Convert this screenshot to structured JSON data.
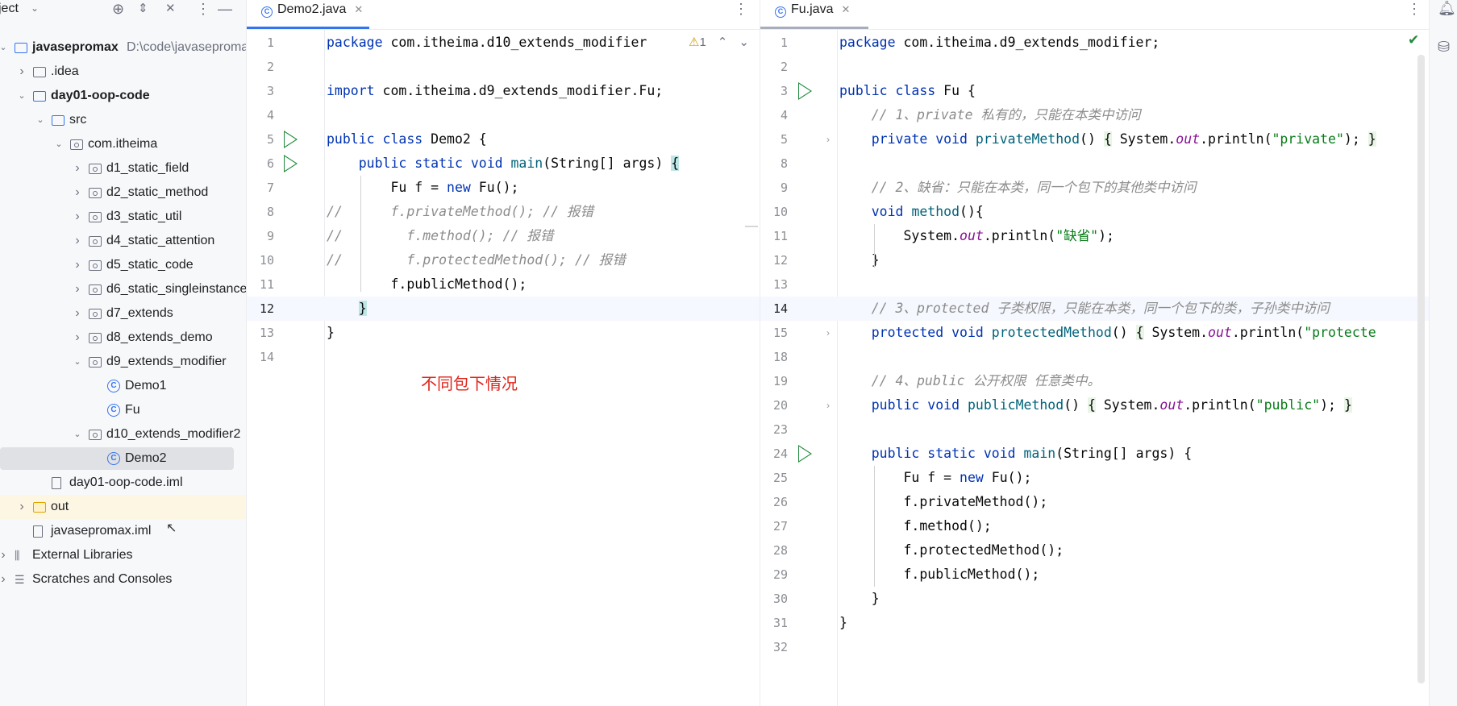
{
  "project_panel": {
    "title": "ject",
    "tree": [
      {
        "label": "javasepromax",
        "path": "D:\\code\\javasepromax",
        "icon": "module-folder-icon",
        "indent": 0,
        "arrow": "down",
        "bold": true
      },
      {
        "label": ".idea",
        "icon": "folder-icon",
        "indent": 1,
        "arrow": "right"
      },
      {
        "label": "day01-oop-code",
        "icon": "module-folder-icon",
        "indent": 1,
        "arrow": "down",
        "bold": true
      },
      {
        "label": "src",
        "icon": "source-folder-icon",
        "indent": 2,
        "arrow": "down"
      },
      {
        "label": "com.itheima",
        "icon": "package-icon",
        "indent": 3,
        "arrow": "down"
      },
      {
        "label": "d1_static_field",
        "icon": "package-icon",
        "indent": 4,
        "arrow": "right"
      },
      {
        "label": "d2_static_method",
        "icon": "package-icon",
        "indent": 4,
        "arrow": "right"
      },
      {
        "label": "d3_static_util",
        "icon": "package-icon",
        "indent": 4,
        "arrow": "right"
      },
      {
        "label": "d4_static_attention",
        "icon": "package-icon",
        "indent": 4,
        "arrow": "right"
      },
      {
        "label": "d5_static_code",
        "icon": "package-icon",
        "indent": 4,
        "arrow": "right"
      },
      {
        "label": "d6_static_singleinstance",
        "icon": "package-icon",
        "indent": 4,
        "arrow": "right"
      },
      {
        "label": "d7_extends",
        "icon": "package-icon",
        "indent": 4,
        "arrow": "right"
      },
      {
        "label": "d8_extends_demo",
        "icon": "package-icon",
        "indent": 4,
        "arrow": "right"
      },
      {
        "label": "d9_extends_modifier",
        "icon": "package-icon",
        "indent": 4,
        "arrow": "down"
      },
      {
        "label": "Demo1",
        "icon": "class-icon",
        "indent": 5,
        "arrow": ""
      },
      {
        "label": "Fu",
        "icon": "class-icon",
        "indent": 5,
        "arrow": ""
      },
      {
        "label": "d10_extends_modifier2",
        "icon": "package-icon",
        "indent": 4,
        "arrow": "down"
      },
      {
        "label": "Demo2",
        "icon": "class-icon",
        "indent": 5,
        "arrow": "",
        "selected": true
      },
      {
        "label": "day01-oop-code.iml",
        "icon": "iml-file-icon",
        "indent": 2,
        "arrow": ""
      },
      {
        "label": "out",
        "icon": "excluded-folder-icon",
        "indent": 1,
        "arrow": "right",
        "highlight": true
      },
      {
        "label": "javasepromax.iml",
        "icon": "iml-file-icon",
        "indent": 1,
        "arrow": ""
      },
      {
        "label": "External Libraries",
        "icon": "libraries-icon",
        "indent": 0,
        "arrow": "right"
      },
      {
        "label": "Scratches and Consoles",
        "icon": "scratches-icon",
        "indent": 0,
        "arrow": "right"
      }
    ]
  },
  "left_editor": {
    "tab_label": "Demo2.java",
    "warning_count": "1",
    "current_line": "12",
    "lines": [
      {
        "n": "1",
        "html": "<span class=\"kw\">package</span> com.itheima.d10_extends_modifier"
      },
      {
        "n": "2",
        "html": ""
      },
      {
        "n": "3",
        "html": "<span class=\"kw\">import</span> com.itheima.d9_extends_modifier.Fu;"
      },
      {
        "n": "4",
        "html": ""
      },
      {
        "n": "5",
        "html": "<span class=\"kw\">public class</span> Demo2 {",
        "run": true
      },
      {
        "n": "6",
        "html": "    <span class=\"kw\">public static void</span> <span class=\"mdecl\">main</span>(String[] args) <span class=\"brh\">{</span>",
        "run": true
      },
      {
        "n": "7",
        "html": "        Fu f = <span class=\"kw\">new</span> Fu();"
      },
      {
        "n": "8",
        "html": "<span class=\"cmt\">//      f.privateMethod(); // 报错</span>"
      },
      {
        "n": "9",
        "html": "<span class=\"cmt\">//        f.method(); // 报错</span>"
      },
      {
        "n": "10",
        "html": "<span class=\"cmt\">//        f.protectedMethod(); // 报错</span>"
      },
      {
        "n": "11",
        "html": "        f.publicMethod();"
      },
      {
        "n": "12",
        "html": "    <span class=\"brh\">}</span>"
      },
      {
        "n": "13",
        "html": "}"
      },
      {
        "n": "14",
        "html": ""
      }
    ],
    "annotation": "不同包下情况"
  },
  "right_editor": {
    "tab_label": "Fu.java",
    "current_line": "14",
    "lines": [
      {
        "n": "1",
        "html": "<span class=\"kw\">package</span> com.itheima.d9_extends_modifier;"
      },
      {
        "n": "2",
        "html": ""
      },
      {
        "n": "3",
        "html": "<span class=\"kw\">public class</span> Fu {",
        "run": true
      },
      {
        "n": "4",
        "html": "    <span class=\"cmt\">// 1、private 私有的，只能在本类中访问</span>"
      },
      {
        "n": "5",
        "html": "    <span class=\"kw\">private void</span> <span class=\"mdecl\">privateMethod</span>() <span class=\"fold-bg\">{</span> System.<span class=\"fld\">out</span>.println(<span class=\"str\">\"private\"</span>); <span class=\"fold-bg\">}</span>",
        "fold": true
      },
      {
        "n": "8",
        "html": ""
      },
      {
        "n": "9",
        "html": "    <span class=\"cmt\">// 2、缺省：只能在本类，同一个包下的其他类中访问</span>"
      },
      {
        "n": "10",
        "html": "    <span class=\"kw\">void</span> <span class=\"mdecl\">method</span>(){"
      },
      {
        "n": "11",
        "html": "        System.<span class=\"fld\">out</span>.println(<span class=\"str\">\"缺省\"</span>);"
      },
      {
        "n": "12",
        "html": "    }"
      },
      {
        "n": "13",
        "html": ""
      },
      {
        "n": "14",
        "html": "    <span class=\"cmt\">// 3、protected 子类权限，只能在本类，同一个包下的类，子孙类中访问</span>"
      },
      {
        "n": "15",
        "html": "    <span class=\"kw\">protected void</span> <span class=\"mdecl\">protectedMethod</span>() <span class=\"fold-bg\">{</span> System.<span class=\"fld\">out</span>.println(<span class=\"str\">\"protecte</span>",
        "fold": true
      },
      {
        "n": "18",
        "html": ""
      },
      {
        "n": "19",
        "html": "    <span class=\"cmt\">// 4、public 公开权限 任意类中。</span>"
      },
      {
        "n": "20",
        "html": "    <span class=\"kw\">public void</span> <span class=\"mdecl\">publicMethod</span>() <span class=\"fold-bg\">{</span> System.<span class=\"fld\">out</span>.println(<span class=\"str\">\"public\"</span>); <span class=\"fold-bg\">}</span>",
        "fold": true
      },
      {
        "n": "23",
        "html": ""
      },
      {
        "n": "24",
        "html": "    <span class=\"kw\">public static void</span> <span class=\"mdecl\">main</span>(String[] args) {",
        "run": true
      },
      {
        "n": "25",
        "html": "        Fu f = <span class=\"kw\">new</span> Fu();"
      },
      {
        "n": "26",
        "html": "        f.privateMethod();"
      },
      {
        "n": "27",
        "html": "        f.method();"
      },
      {
        "n": "28",
        "html": "        f.protectedMethod();"
      },
      {
        "n": "29",
        "html": "        f.publicMethod();"
      },
      {
        "n": "30",
        "html": "    }"
      },
      {
        "n": "31",
        "html": "}"
      },
      {
        "n": "32",
        "html": ""
      }
    ]
  },
  "colors": {
    "accent": "#3574f0",
    "run_icon": "#208a3c",
    "annotation": "#e0231a",
    "keyword": "#0033b3",
    "string": "#067d17",
    "comment": "#8c8c8c"
  }
}
